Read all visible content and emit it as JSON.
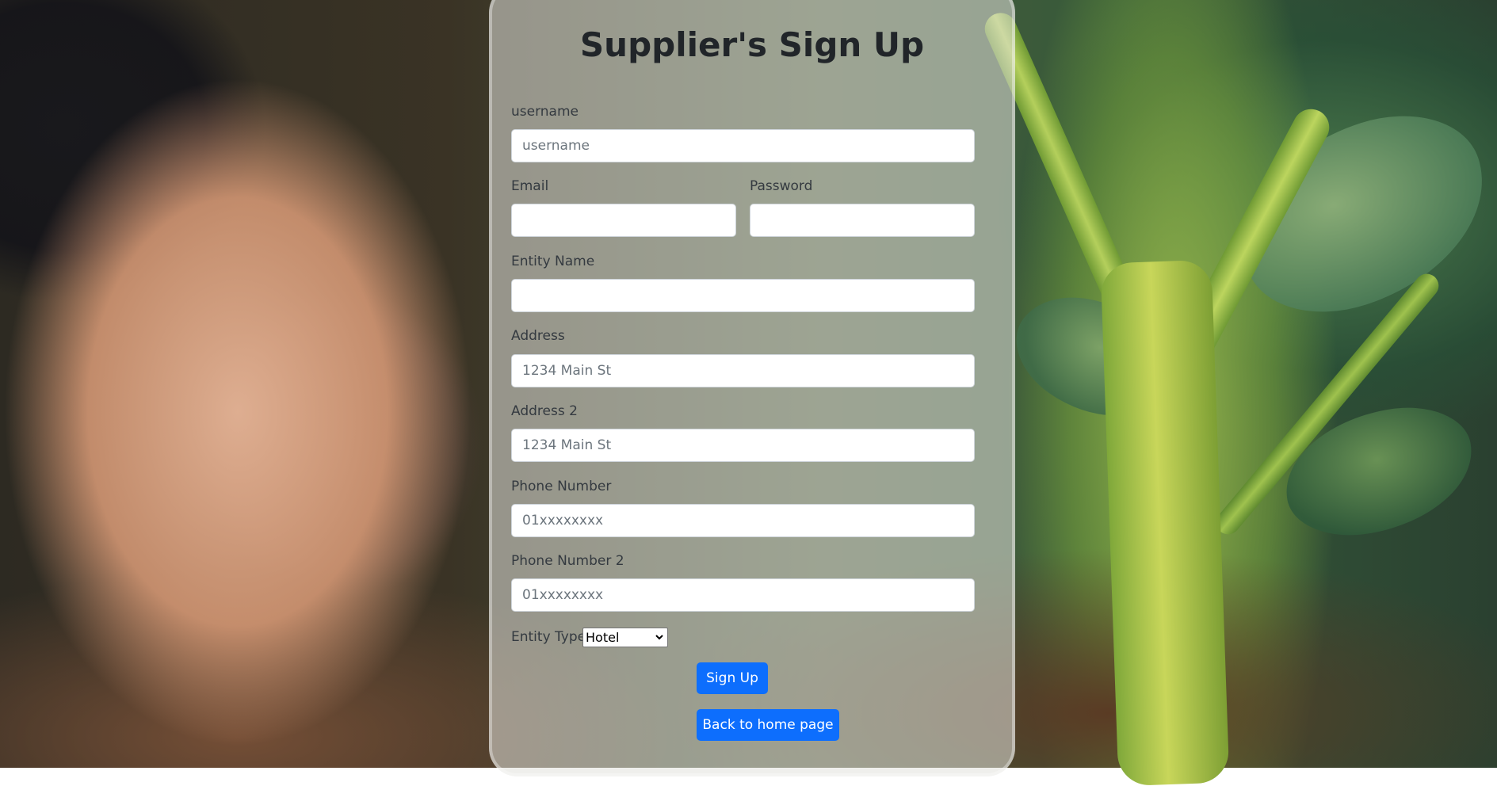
{
  "page": {
    "title": "Supplier's Sign Up"
  },
  "form": {
    "username": {
      "label": "username",
      "placeholder": "username",
      "value": ""
    },
    "email": {
      "label": "Email",
      "placeholder": "",
      "value": ""
    },
    "password": {
      "label": "Password",
      "placeholder": "",
      "value": ""
    },
    "entity_name": {
      "label": "Entity Name",
      "placeholder": "",
      "value": ""
    },
    "address": {
      "label": "Address",
      "placeholder": "1234 Main St",
      "value": ""
    },
    "address2": {
      "label": "Address 2",
      "placeholder": "1234 Main St",
      "value": ""
    },
    "phone": {
      "label": "Phone Number",
      "placeholder": "01xxxxxxxx",
      "value": ""
    },
    "phone2": {
      "label": "Phone Number 2",
      "placeholder": "01xxxxxxxx",
      "value": ""
    },
    "entity_type": {
      "label": "Entity Type",
      "selected": "Hotel"
    },
    "signup_label": "Sign Up",
    "back_label": "Back to home page"
  },
  "colors": {
    "primary_button": "#0d6efd",
    "card_overlay": "rgba(225,225,220,0.55)"
  },
  "icons": {
    "select_arrow": "chevron-down-icon"
  }
}
